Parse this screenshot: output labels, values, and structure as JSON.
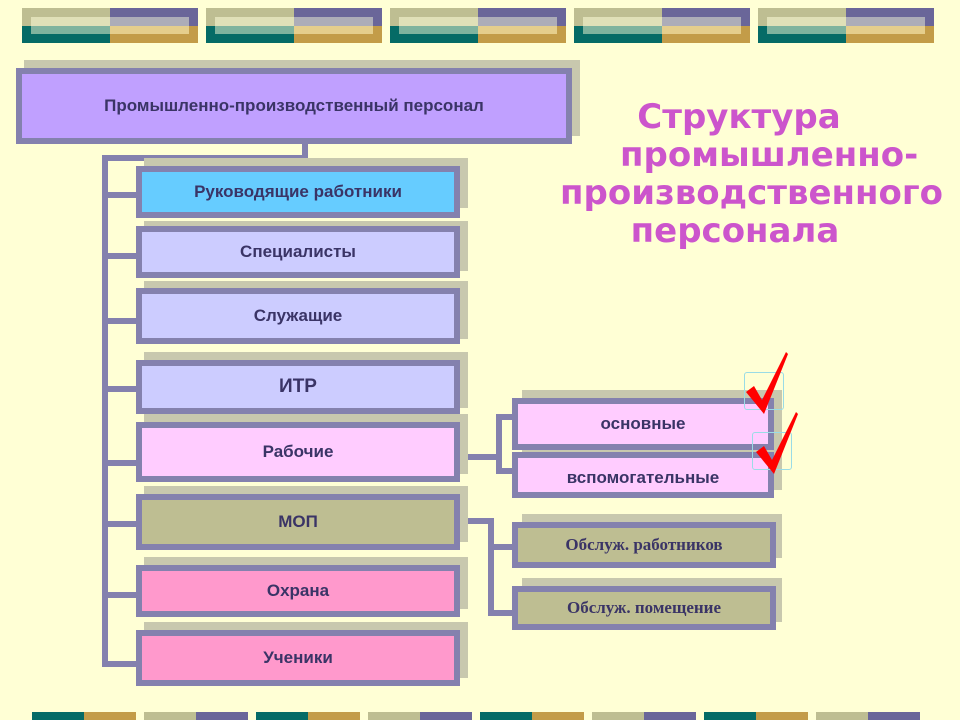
{
  "title": {
    "lines": [
      "Структура",
      "промышленно-",
      "производственного",
      "персонала"
    ]
  },
  "root": {
    "label": "Промышленно-производственный персонал",
    "fill": "#C0A0FF"
  },
  "categories": [
    {
      "label": "Руководящие работники",
      "fill": "#66CCFF"
    },
    {
      "label": "Специалисты",
      "fill": "#CCCCFF"
    },
    {
      "label": "Служащие",
      "fill": "#CCCCFF"
    },
    {
      "label": "ИТР",
      "fill": "#CCCCFF"
    },
    {
      "label": "Рабочие",
      "fill": "#FFCCFF"
    },
    {
      "label": "МОП",
      "fill": "#BEBE92"
    },
    {
      "label": "Охрана",
      "fill": "#FF99CC"
    },
    {
      "label": "Ученики",
      "fill": "#FF99CC"
    }
  ],
  "workers_subtypes": [
    {
      "label": "основные",
      "fill": "#FFCCFF",
      "checked": true
    },
    {
      "label": "вспомогательные",
      "fill": "#FFCCFF",
      "checked": true
    }
  ],
  "mop_subtypes": [
    {
      "label": "Обслуж. работников",
      "fill": "#BEBE92"
    },
    {
      "label": "Обслуж. помещение",
      "fill": "#BEBE92"
    }
  ],
  "icons": {
    "check": "checkmark-icon"
  },
  "colors": {
    "background": "#FFFFD5",
    "connector": "#8481AE",
    "text": "#3A3466",
    "title": "#CC55CC",
    "check": "#FF0000"
  }
}
